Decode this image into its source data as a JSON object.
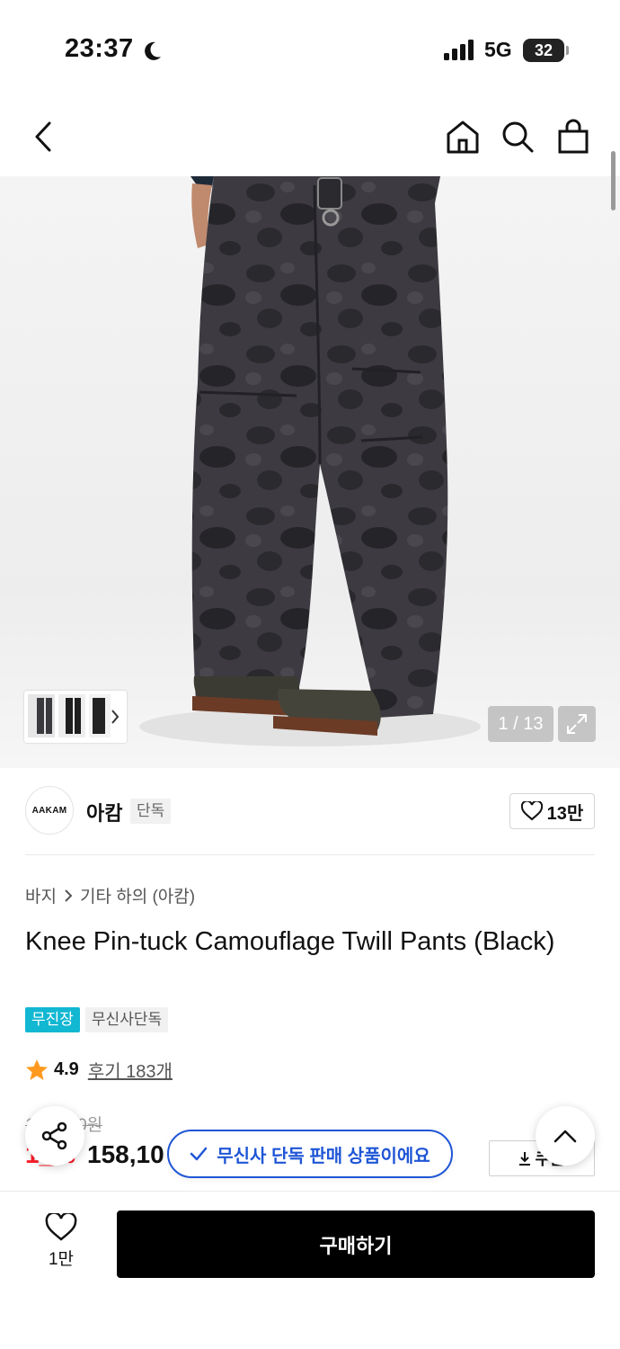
{
  "status_bar": {
    "time": "23:37",
    "network": "5G",
    "battery": "32"
  },
  "nav": {
    "icons": [
      "back-icon",
      "home-icon",
      "search-icon",
      "shopping-bag-icon"
    ]
  },
  "gallery": {
    "counter": "1 / 13"
  },
  "brand": {
    "logo_text": "AAKAM",
    "name": "아캄",
    "tag": "단독",
    "likes": "13만"
  },
  "breadcrumb": {
    "category": "바지",
    "subcategory": "기타 하의 (아캄)"
  },
  "product": {
    "title": "Knee Pin-tuck Camouflage Twill Pants (Black)",
    "badges": [
      "무진장",
      "무신사단독"
    ],
    "rating": "4.9",
    "reviews": "후기 183개"
  },
  "price": {
    "original": "1__,_00원",
    "discount": "1_%",
    "sale": "158,10",
    "coupon_label": "쿠폰"
  },
  "floating": {
    "exclusive_notice": "무신사 단독 판매 상품이에요"
  },
  "bottom_bar": {
    "like_count": "1만",
    "buy_label": "구매하기"
  },
  "colors": {
    "accent_blue": "#1f56d6",
    "badge_cyan": "#12b7d2",
    "discount_red": "#ff1f2d",
    "star_orange": "#ff9a1f"
  }
}
